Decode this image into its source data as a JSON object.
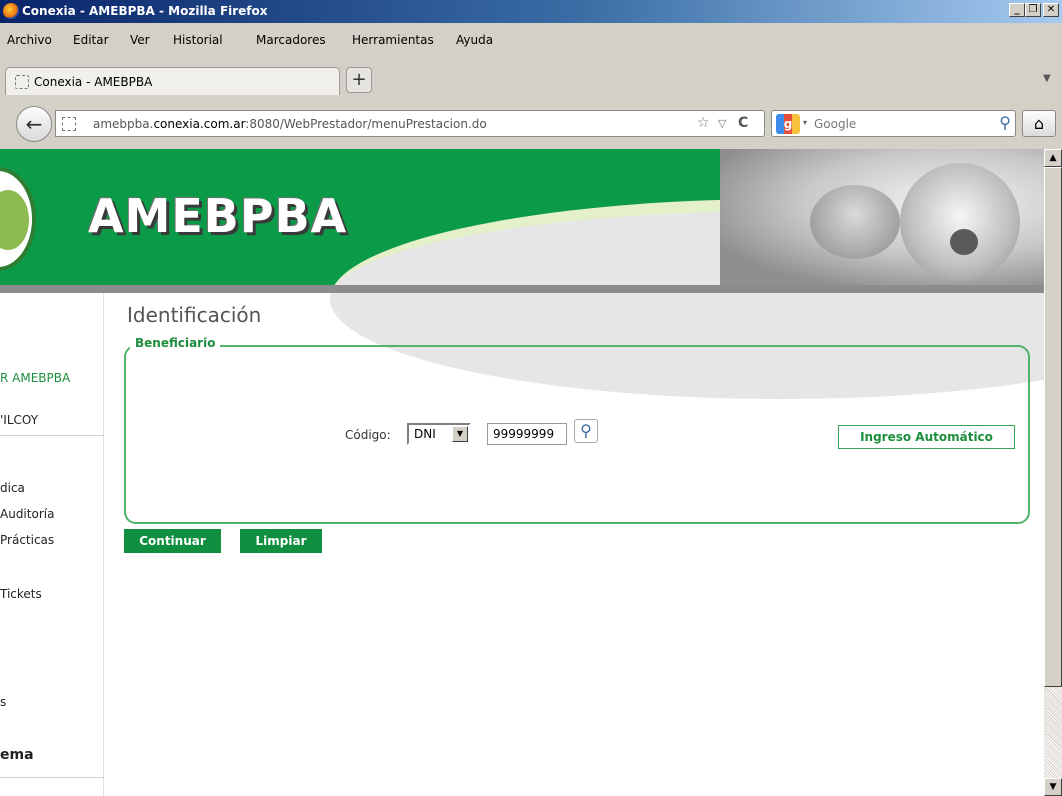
{
  "window": {
    "title": "Conexia - AMEBPBA - Mozilla Firefox",
    "min_glyph": "_",
    "max_glyph": "❐",
    "close_glyph": "✕"
  },
  "menu": [
    "Archivo",
    "Editar",
    "Ver",
    "Historial",
    "Marcadores",
    "Herramientas",
    "Ayuda"
  ],
  "tab": {
    "label": "Conexia - AMEBPBA",
    "new_tab": "+",
    "list_glyph": "▼"
  },
  "nav": {
    "back_glyph": "←",
    "url_host": "amebpba.",
    "url_domain": "conexia.com.ar",
    "url_rest": ":8080/WebPrestador/menuPrestacion.do",
    "star_glyph": "☆",
    "dropdown_glyph": "▽",
    "reload_glyph": "C",
    "search_engine_glyph": "g",
    "search_arrow_glyph": "▾",
    "search_placeholder": "Google",
    "search_icon_glyph": "⚲",
    "home_glyph": "⌂"
  },
  "banner": {
    "logo_text": "AMEBPBA"
  },
  "sidebar": {
    "items": [
      "R AMEBPBA",
      "'ILCOY",
      "dica",
      "Auditoría",
      "Prácticas",
      "Tickets",
      "s",
      "ema"
    ]
  },
  "page": {
    "title": "Identificación",
    "fieldset_legend": "Beneficiario",
    "codigo_label": "Código:",
    "doc_type": "DNI",
    "select_arrow_glyph": "▼",
    "doc_number": "99999999",
    "lookup_glyph": "⚲",
    "auto_button": "Ingreso Automático",
    "continue_button": "Continuar",
    "clear_button": "Limpiar"
  },
  "scrollbar": {
    "up_glyph": "▲",
    "down_glyph": "▼"
  },
  "colors": {
    "brand_green": "#0b9a47",
    "accent_green": "#1d8e3d",
    "button_green": "#0f8f3f",
    "titlebar": "#0a246a"
  }
}
